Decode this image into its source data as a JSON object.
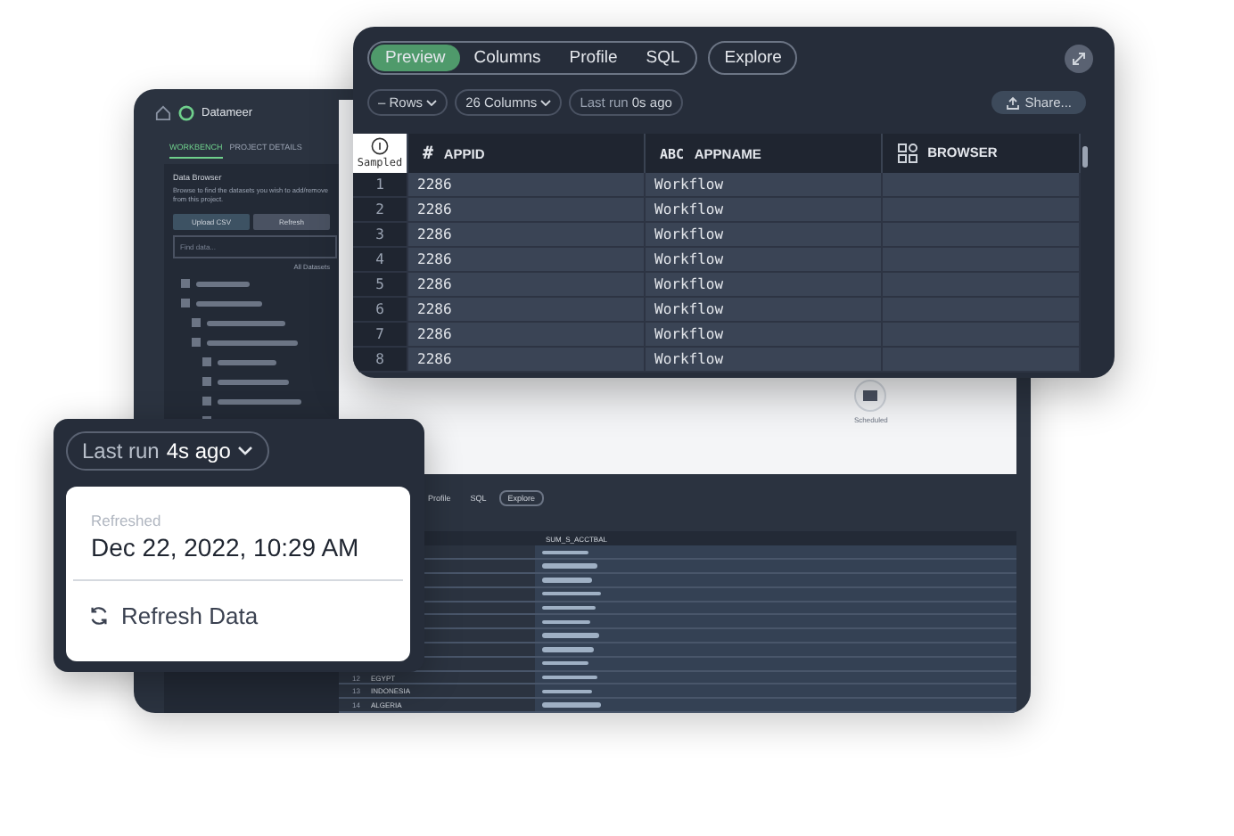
{
  "back_window": {
    "app_name": "Datameer",
    "nav_tabs": [
      {
        "label": "WORKBENCH",
        "selected": true
      },
      {
        "label": "PROJECT DETAILS",
        "selected": false
      }
    ],
    "data_browser": {
      "title": "Data Browser",
      "description": "Browse to find the datasets you wish to add/remove from this project.",
      "upload_button": "Upload CSV",
      "refresh_button": "Refresh",
      "search": {
        "placeholder": "Find data..."
      },
      "filter": "All Datasets"
    },
    "canvas_node": {
      "label": "Scheduled"
    },
    "lower_pane": {
      "tabs": [
        "Profile",
        "SQL"
      ],
      "explore_button": "Explore",
      "column": "SUM_S_ACCTBAL",
      "rows": [
        {
          "index": "12",
          "name": "EGYPT"
        },
        {
          "index": "13",
          "name": "INDONESIA"
        },
        {
          "index": "14",
          "name": "ALGERIA"
        }
      ]
    }
  },
  "main_panel": {
    "tabs": [
      {
        "label": "Preview",
        "selected": true
      },
      {
        "label": "Columns",
        "selected": false
      },
      {
        "label": "Profile",
        "selected": false
      },
      {
        "label": "SQL",
        "selected": false
      }
    ],
    "explore_button": "Explore",
    "filters": [
      "– Rows",
      "26 Columns"
    ],
    "last_run": {
      "label": "Last run",
      "value": "0s ago"
    },
    "share_button": "Share...",
    "sampled_label": "Sampled",
    "columns": [
      {
        "kind": "number",
        "type_label": "#",
        "name": "APPID"
      },
      {
        "kind": "text",
        "type_label": "ABC",
        "name": "APPNAME"
      },
      {
        "kind": "category",
        "name": "BROWSER"
      }
    ],
    "rows": [
      {
        "index": "1",
        "cells": [
          "2286",
          "Workflow"
        ]
      },
      {
        "index": "2",
        "cells": [
          "2286",
          "Workflow"
        ]
      },
      {
        "index": "3",
        "cells": [
          "2286",
          "Workflow"
        ]
      },
      {
        "index": "4",
        "cells": [
          "2286",
          "Workflow"
        ]
      },
      {
        "index": "5",
        "cells": [
          "2286",
          "Workflow"
        ]
      },
      {
        "index": "6",
        "cells": [
          "2286",
          "Workflow"
        ]
      },
      {
        "index": "7",
        "cells": [
          "2286",
          "Workflow"
        ]
      },
      {
        "index": "8",
        "cells": [
          "2286",
          "Workflow"
        ]
      }
    ]
  },
  "popup": {
    "last_run": {
      "label": "Last run",
      "value": "4s ago"
    },
    "refreshed_label": "Refreshed",
    "refreshed_time": "Dec 22, 2022, 10:29 AM",
    "refresh_button": "Refresh Data"
  }
}
